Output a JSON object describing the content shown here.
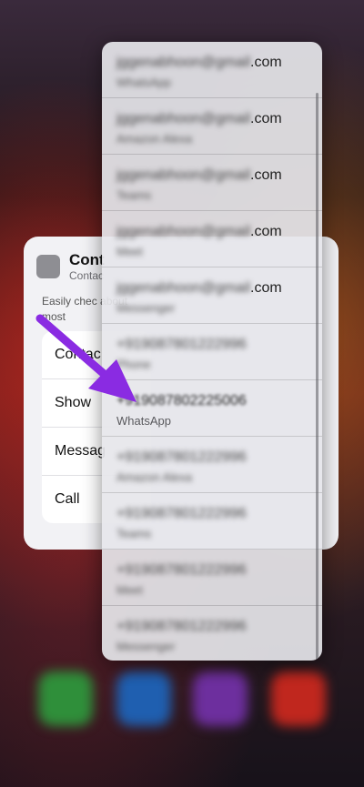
{
  "contact_card": {
    "title": "Cont",
    "subtitle": "Contac",
    "description": "Easily chec about most",
    "actions": [
      "Contac",
      "Show",
      "Messag",
      "Call"
    ]
  },
  "copy_menu": {
    "items": [
      {
        "value": "jggenabhoon@gmail",
        "suffix": ".com",
        "app": "WhatsApp",
        "blurred": true
      },
      {
        "value": "jggenabhoon@gmail",
        "suffix": ".com",
        "app": "Amazon Alexa",
        "blurred": true
      },
      {
        "value": "jggenabhoon@gmail",
        "suffix": ".com",
        "app": "Teams",
        "blurred": true
      },
      {
        "value": "jggenabhoon@gmail",
        "suffix": ".com",
        "app": "Meet",
        "blurred": true
      },
      {
        "value": "jggenabhoon@gmail",
        "suffix": ".com",
        "app": "Messenger",
        "blurred": true
      },
      {
        "value": "+919087801222996",
        "suffix": "",
        "app": "Phone",
        "blurred": true
      },
      {
        "value": "+919087802225006",
        "suffix": "",
        "app": "WhatsApp",
        "blurred": false
      },
      {
        "value": "+919087801222996",
        "suffix": "",
        "app": "Amazon Alexa",
        "blurred": true
      },
      {
        "value": "+919087801222996",
        "suffix": "",
        "app": "Teams",
        "blurred": true
      },
      {
        "value": "+919087801222996",
        "suffix": "",
        "app": "Meet",
        "blurred": true
      },
      {
        "value": "+919087801222996",
        "suffix": "",
        "app": "Messenger",
        "blurred": true
      }
    ]
  },
  "colors": {
    "arrow": "#8a2be2",
    "menu_bg": "#e6e6ea",
    "card_bg": "#f2f2f5"
  }
}
